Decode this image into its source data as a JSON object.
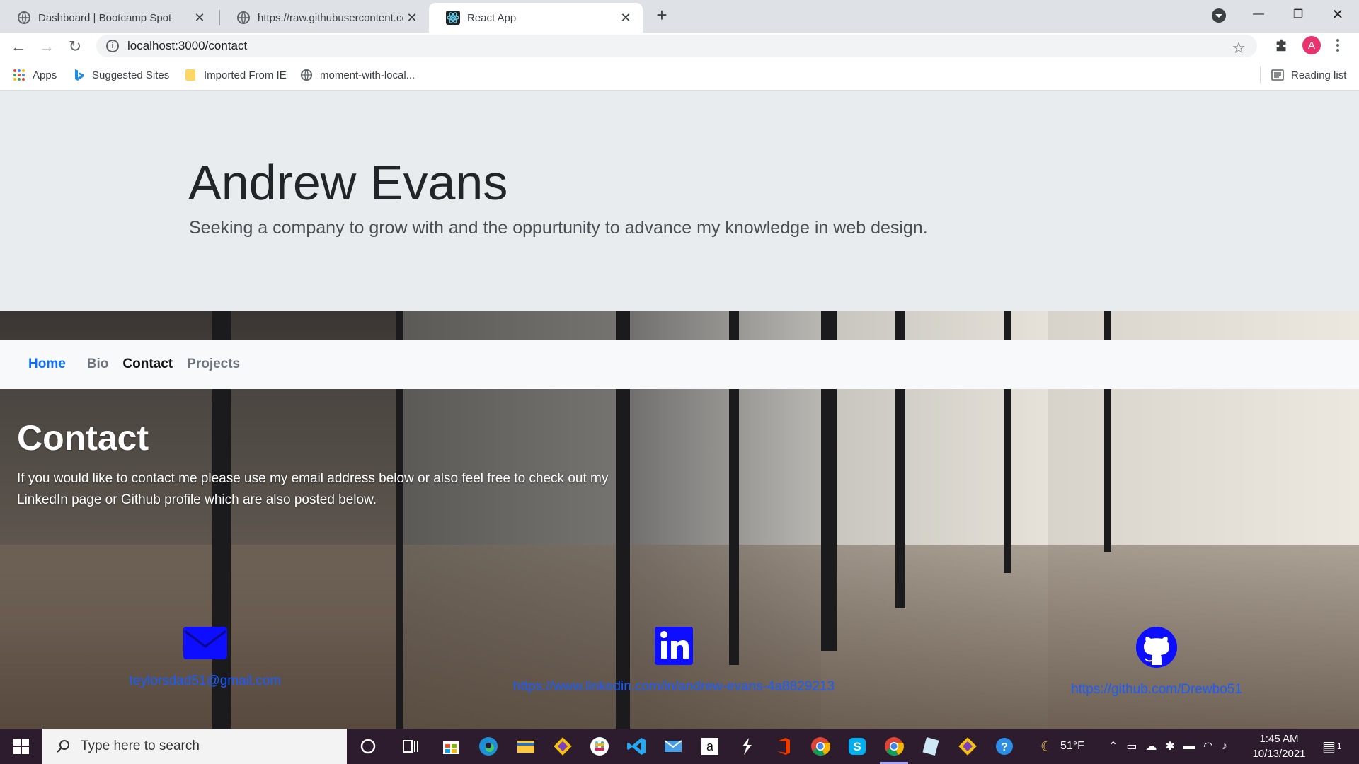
{
  "browser": {
    "tabs": [
      {
        "title": "Dashboard | Bootcamp Spot",
        "active": false
      },
      {
        "title": "https://raw.githubusercontent.co",
        "active": false
      },
      {
        "title": "React App",
        "active": true
      }
    ],
    "url": "localhost:3000/contact",
    "profile_initial": "A",
    "bookmarks": [
      "Apps",
      "Suggested Sites",
      "Imported From IE",
      "moment-with-local..."
    ],
    "reading_list": "Reading list"
  },
  "page": {
    "name": "Andrew Evans",
    "tagline": "Seeking a company to grow with and the oppurtunity to advance my knowledge in web design.",
    "nav": {
      "home": "Home",
      "bio": "Bio",
      "contact": "Contact",
      "projects": "Projects"
    },
    "contact": {
      "title": "Contact",
      "text": "If you would like to contact me please use my email address below or also feel free to check out my LinkedIn page or Github profile which are also posted below.",
      "email": "teylorsdad51@gmail.com",
      "linkedin": "https://www.linkedin.com/in/andrew-evans-4a8829213",
      "github": "https://github.com/Drewbo51"
    },
    "accent_color": "#0d0dff",
    "link_color": "#1a5cff"
  },
  "taskbar": {
    "search_placeholder": "Type here to search",
    "weather": "51°F",
    "time": "1:45 AM",
    "date": "10/13/2021",
    "notification_count": "1"
  }
}
